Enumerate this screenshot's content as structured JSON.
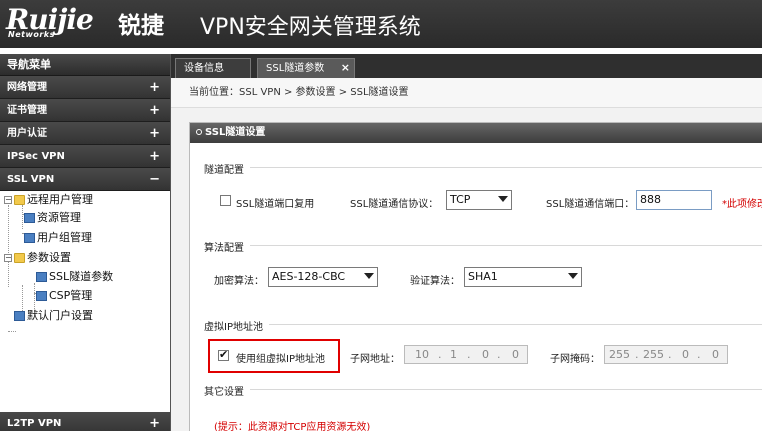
{
  "header": {
    "logo": "Ruijie",
    "logo_sub": "Networks",
    "logo_cn": "锐捷",
    "title": "VPN安全网关管理系统"
  },
  "sidebar": {
    "heading": "导航菜单",
    "categories": [
      {
        "label": "网络管理",
        "sign": "+"
      },
      {
        "label": "证书管理",
        "sign": "+"
      },
      {
        "label": "用户认证",
        "sign": "+"
      },
      {
        "label": "IPSec VPN",
        "sign": "+"
      },
      {
        "label": "SSL VPN",
        "sign": "−"
      }
    ],
    "tree": {
      "remote_user_mgmt": "远程用户管理",
      "resource_mgmt": "资源管理",
      "user_group_mgmt": "用户组管理",
      "param_settings": "参数设置",
      "ssl_tunnel_params": "SSL隧道参数",
      "csp_mgmt": "CSP管理",
      "default_portal": "默认门户设置"
    },
    "bottom_category": {
      "label": "L2TP VPN",
      "sign": "+"
    }
  },
  "tabs": [
    {
      "label": "设备信息"
    },
    {
      "label": "SSL隧道参数",
      "close": "×"
    }
  ],
  "breadcrumb": "当前位置：SSL VPN > 参数设置 > SSL隧道设置",
  "panel": {
    "title": "SSL隧道设置",
    "tunnel": {
      "legend": "隧道配置",
      "port_reuse_label": "SSL隧道端口复用",
      "protocol_label": "SSL隧道通信协议：",
      "protocol_value": "TCP",
      "port_label": "SSL隧道通信端口：",
      "port_value": "888",
      "warning": "*此项修改"
    },
    "algo": {
      "legend": "算法配置",
      "enc_label": "加密算法：",
      "enc_value": "AES-128-CBC",
      "auth_label": "验证算法：",
      "auth_value": "SHA1"
    },
    "pool": {
      "legend": "虚拟IP地址池",
      "use_group_label": "使用组虚拟IP地址池",
      "subnet_label": "子网地址：",
      "subnet": [
        "10",
        "1",
        "0",
        "0"
      ],
      "mask_label": "子网掩码：",
      "mask": [
        "255",
        "255",
        "0",
        "0"
      ]
    },
    "other": {
      "legend": "其它设置",
      "hint": "(提示：此资源对TCP应用资源无效)"
    }
  },
  "colors": {
    "highlight_box": "#e00000",
    "warning_text": "#d40000"
  }
}
